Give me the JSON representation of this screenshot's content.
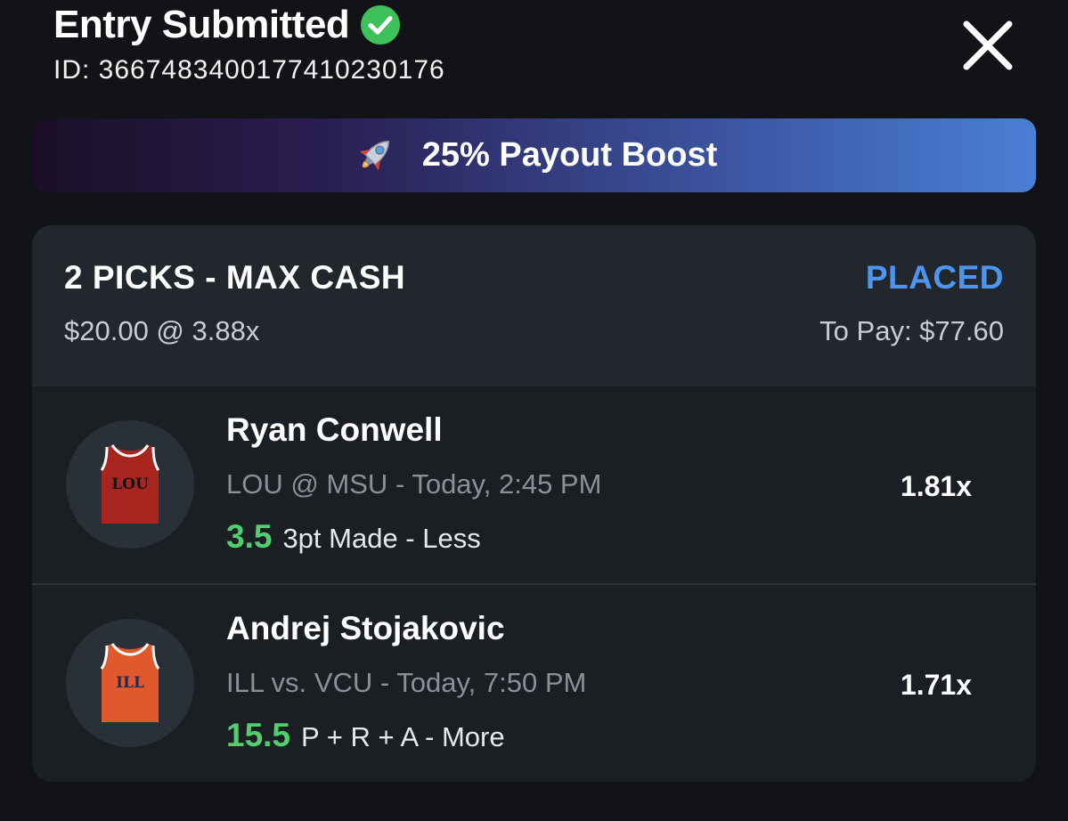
{
  "header": {
    "title": "Entry Submitted",
    "entry_id": "ID: 3667483400177410230176",
    "icons": {
      "status": "check-circle-icon",
      "close": "close-icon"
    }
  },
  "boost": {
    "label": "25% Payout Boost",
    "icon": "rocket-icon"
  },
  "entry": {
    "title": "2 PICKS - MAX CASH",
    "stake": "$20.00 @ 3.88x",
    "status": "PLACED",
    "to_pay": "To Pay: $77.60",
    "picks": [
      {
        "player": "Ryan Conwell",
        "game": "LOU @ MSU",
        "time": "- Today, 2:45 PM",
        "line": "3.5",
        "stat": "3pt Made - Less",
        "multiplier": "1.81x",
        "jersey_text": "LOU",
        "jersey_color": "#a8251f"
      },
      {
        "player": "Andrej Stojakovic",
        "game": "ILL vs. VCU",
        "time": "- Today, 7:50 PM",
        "line": "15.5",
        "stat": "P + R + A - More",
        "multiplier": "1.71x",
        "jersey_text": "ILL",
        "jersey_color": "#e0592c"
      }
    ]
  },
  "colors": {
    "background": "#111316",
    "card": "#22272d",
    "row": "#1b1f24",
    "status_blue": "#4d96ef",
    "line_green": "#4fcf6e",
    "check_green": "#3ec15a"
  }
}
